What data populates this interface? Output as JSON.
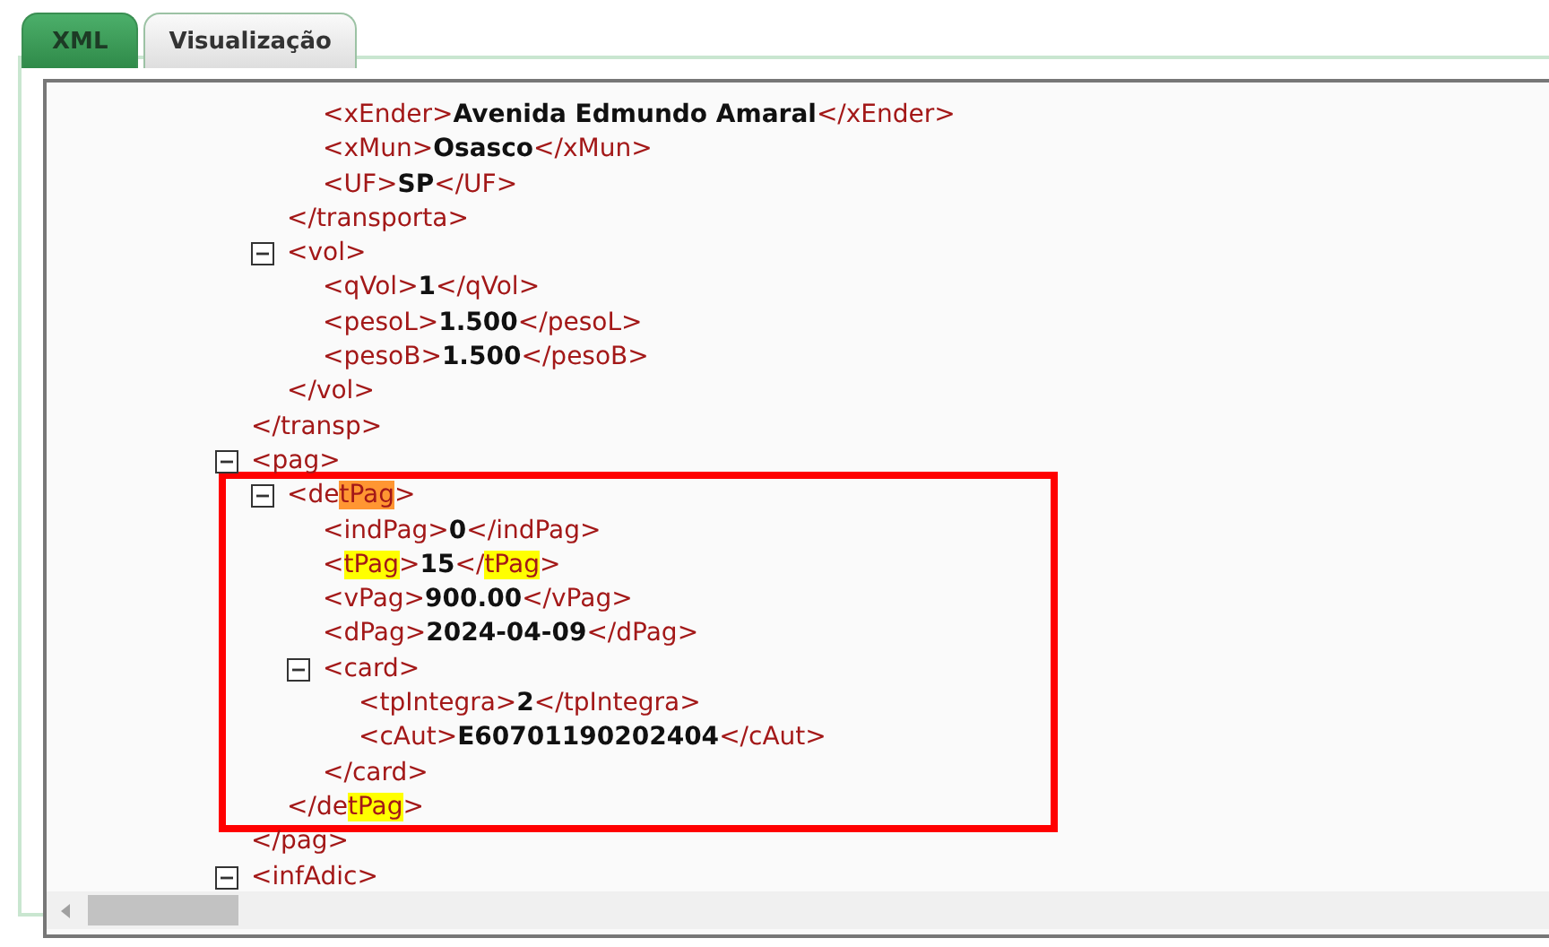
{
  "tabs": [
    {
      "label": "XML",
      "selected": true
    },
    {
      "label": "Visualização",
      "selected": false
    }
  ],
  "xml_tree": [
    {
      "close": [
        {
          "kind": "tag",
          "text": "</transp>"
        }
      ],
      "children": [
        {
          "close": [
            {
              "kind": "tag",
              "text": "</transporta>"
            }
          ],
          "children": [
            {
              "parts": [
                {
                  "kind": "tag",
                  "text": "<xEnder>"
                },
                {
                  "kind": "value",
                  "text": "Avenida Edmundo Amaral"
                },
                {
                  "kind": "tag",
                  "text": "</xEnder>"
                }
              ]
            },
            {
              "parts": [
                {
                  "kind": "tag",
                  "text": "<xMun>"
                },
                {
                  "kind": "value",
                  "text": "Osasco"
                },
                {
                  "kind": "tag",
                  "text": "</xMun>"
                }
              ]
            },
            {
              "parts": [
                {
                  "kind": "tag",
                  "text": "<UF>"
                },
                {
                  "kind": "value",
                  "text": "SP"
                },
                {
                  "kind": "tag",
                  "text": "</UF>"
                }
              ]
            }
          ]
        },
        {
          "expanded": true,
          "open": [
            {
              "kind": "tag",
              "text": "<vol>"
            }
          ],
          "close": [
            {
              "kind": "tag",
              "text": "</vol>"
            }
          ],
          "children": [
            {
              "parts": [
                {
                  "kind": "tag",
                  "text": "<qVol>"
                },
                {
                  "kind": "value",
                  "text": "1"
                },
                {
                  "kind": "tag",
                  "text": "</qVol>"
                }
              ]
            },
            {
              "parts": [
                {
                  "kind": "tag",
                  "text": "<pesoL>"
                },
                {
                  "kind": "value",
                  "text": "1.500"
                },
                {
                  "kind": "tag",
                  "text": "</pesoL>"
                }
              ]
            },
            {
              "parts": [
                {
                  "kind": "tag",
                  "text": "<pesoB>"
                },
                {
                  "kind": "value",
                  "text": "1.500"
                },
                {
                  "kind": "tag",
                  "text": "</pesoB>"
                }
              ]
            }
          ]
        }
      ]
    },
    {
      "expanded": true,
      "open": [
        {
          "kind": "tag",
          "text": "<pag>"
        }
      ],
      "close": [
        {
          "kind": "tag",
          "text": "</pag>"
        }
      ],
      "children": [
        {
          "expanded": true,
          "outlined": true,
          "open": [
            {
              "kind": "tag",
              "text": "<de"
            },
            {
              "kind": "current-match",
              "text": "tPag"
            },
            {
              "kind": "tag",
              "text": ">"
            }
          ],
          "close": [
            {
              "kind": "tag",
              "text": "</de"
            },
            {
              "kind": "match",
              "text": "tPag"
            },
            {
              "kind": "tag",
              "text": ">"
            }
          ],
          "children": [
            {
              "parts": [
                {
                  "kind": "tag",
                  "text": "<indPag>"
                },
                {
                  "kind": "value",
                  "text": "0"
                },
                {
                  "kind": "tag",
                  "text": "</indPag>"
                }
              ]
            },
            {
              "parts": [
                {
                  "kind": "tag",
                  "text": "<"
                },
                {
                  "kind": "match",
                  "text": "tPag"
                },
                {
                  "kind": "tag",
                  "text": ">"
                },
                {
                  "kind": "value",
                  "text": "15"
                },
                {
                  "kind": "tag",
                  "text": "</"
                },
                {
                  "kind": "match",
                  "text": "tPag"
                },
                {
                  "kind": "tag",
                  "text": ">"
                }
              ]
            },
            {
              "parts": [
                {
                  "kind": "tag",
                  "text": "<vPag>"
                },
                {
                  "kind": "value",
                  "text": "900.00"
                },
                {
                  "kind": "tag",
                  "text": "</vPag>"
                }
              ]
            },
            {
              "parts": [
                {
                  "kind": "tag",
                  "text": "<dPag>"
                },
                {
                  "kind": "value",
                  "text": "2024-04-09"
                },
                {
                  "kind": "tag",
                  "text": "</dPag>"
                }
              ]
            },
            {
              "expanded": true,
              "open": [
                {
                  "kind": "tag",
                  "text": "<card>"
                }
              ],
              "close": [
                {
                  "kind": "tag",
                  "text": "</card>"
                }
              ],
              "children": [
                {
                  "parts": [
                    {
                      "kind": "tag",
                      "text": "<tpIntegra>"
                    },
                    {
                      "kind": "value",
                      "text": "2"
                    },
                    {
                      "kind": "tag",
                      "text": "</tpIntegra>"
                    }
                  ]
                },
                {
                  "parts": [
                    {
                      "kind": "tag",
                      "text": "<cAut>"
                    },
                    {
                      "kind": "value",
                      "text": "E60701190202404"
                    },
                    {
                      "kind": "tag",
                      "text": "</cAut>"
                    }
                  ]
                }
              ]
            }
          ]
        }
      ]
    },
    {
      "expanded": true,
      "open": [
        {
          "kind": "tag",
          "text": "<infAdic>"
        }
      ]
    }
  ]
}
